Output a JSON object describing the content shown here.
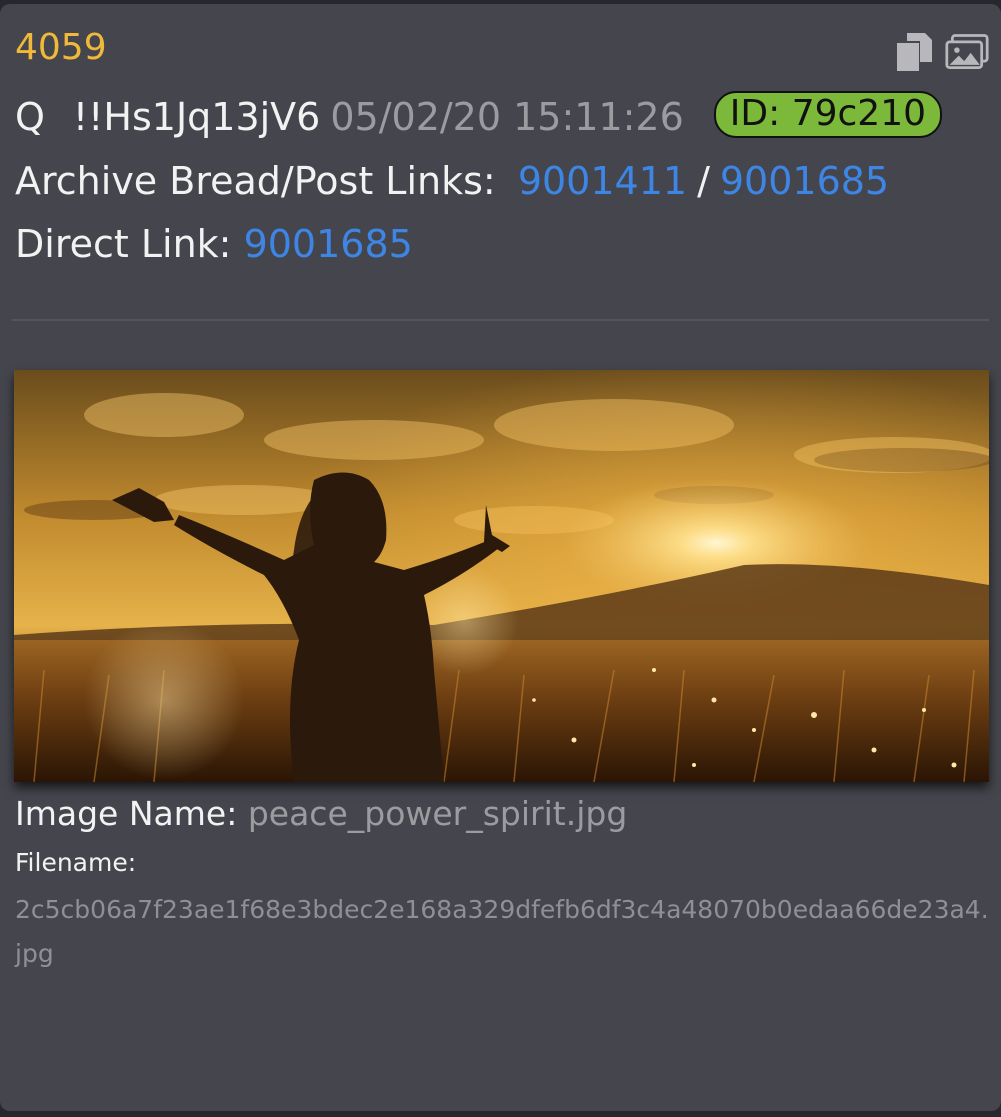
{
  "post": {
    "number": "4059",
    "author_name": "Q",
    "tripcode": "!!Hs1Jq13jV6",
    "timestamp": "05/02/20 15:11:26",
    "id_badge": "ID: 79c210"
  },
  "links": {
    "archive_label": "Archive Bread/Post Links:",
    "archive_bread": "9001411",
    "separator": "/",
    "archive_post": "9001685",
    "direct_label": "Direct Link:",
    "direct_link": "9001685"
  },
  "image": {
    "name_label": "Image Name:",
    "name_value": "peace_power_spirit.jpg",
    "filename_label": "Filename:",
    "filename_value": "2c5cb06a7f23ae1f68e3bdec2e168a329dfefb6df3c4a48070b0edaa66de23a4.jpg"
  },
  "toolbar": {
    "copy_icon": "copy-icon",
    "images_icon": "images-icon"
  },
  "colors": {
    "post_number": "#f0b93a",
    "link": "#3d86e6",
    "id_badge": "#7cb83a",
    "card_background": "#45464d"
  }
}
